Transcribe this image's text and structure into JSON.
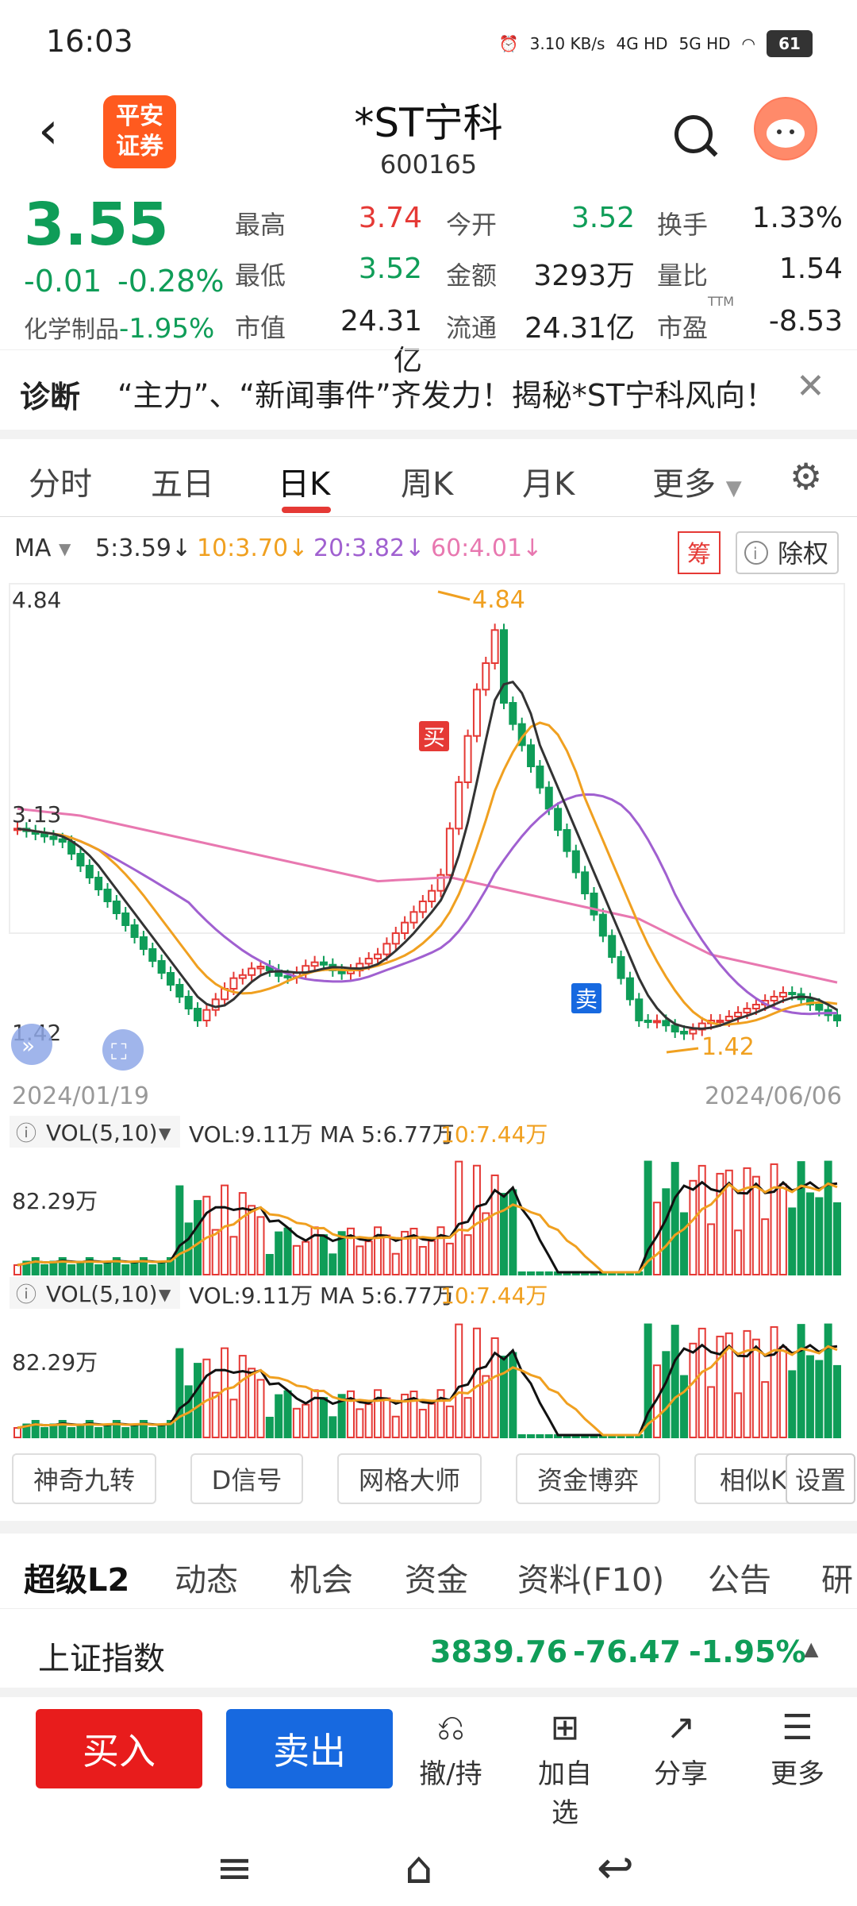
{
  "status": {
    "time": "16:03",
    "net_speed": "3.10 KB/s",
    "sig1": "4G HD",
    "sig2": "5G HD",
    "battery": "61"
  },
  "header": {
    "logo_text": "平安 证券",
    "stock_name": "*ST宁科",
    "stock_code": "600165"
  },
  "quote": {
    "price": "3.55",
    "change": "-0.01",
    "change_pct": "-0.28%",
    "sector_label": "化学制品",
    "sector_pct": "-1.95%",
    "fields": [
      {
        "label": "最高",
        "value": "3.74",
        "color": "red"
      },
      {
        "label": "今开",
        "value": "3.52",
        "color": "green"
      },
      {
        "label": "换手",
        "value": "1.33%",
        "color": "black"
      },
      {
        "label": "最低",
        "value": "3.52",
        "color": "green"
      },
      {
        "label": "金额",
        "value": "3293万",
        "color": "black"
      },
      {
        "label": "量比",
        "value": "1.54",
        "color": "black"
      },
      {
        "label": "市值",
        "value": "24.31亿",
        "color": "black"
      },
      {
        "label": "流通",
        "value": "24.31亿",
        "color": "black"
      },
      {
        "label": "市盈",
        "value": "-8.53",
        "color": "black"
      }
    ],
    "ttm": "TTM"
  },
  "diagnosis": {
    "tag": "诊断",
    "text": "“主力”、“新闻事件”齐发力！揭秘*ST宁科风向！"
  },
  "tabs": [
    "分时",
    "五日",
    "日K",
    "周K",
    "月K",
    "更多"
  ],
  "chart": {
    "ma_label": "MA",
    "ma_items": [
      {
        "text": "5:3.59↓",
        "color": "#333333"
      },
      {
        "text": "10:3.70↓",
        "color": "#f0a020"
      },
      {
        "text": "20:3.82↓",
        "color": "#a060d0"
      },
      {
        "text": "60:4.01↓",
        "color": "#e878b0"
      }
    ],
    "chip_btn": "筹",
    "exright_btn": "除权",
    "y_high": "4.84",
    "y_mid": "3.13",
    "y_low": "1.42",
    "max_label": "4.84",
    "min_label": "1.42",
    "buy_mark": "买",
    "sell_mark": "卖",
    "date_start": "2024/01/19",
    "date_end": "2024/06/06",
    "vol1": {
      "title": "VOL(5,10)",
      "stats": "VOL:9.11万 MA 5:6.77万",
      "ma10": "10:7.44万",
      "scale": "82.29万"
    },
    "vol2": {
      "title": "VOL(5,10)",
      "stats": "VOL:9.11万 MA 5:6.77万",
      "ma10": "10:7.44万",
      "scale": "82.29万"
    }
  },
  "tools": [
    "神奇九转",
    "D信号",
    "网格大师",
    "资金博弈",
    "相似K",
    "设置"
  ],
  "subtabs": [
    "超级L2",
    "动态",
    "机会",
    "资金",
    "资料(F10)",
    "公告",
    "研"
  ],
  "index": {
    "name": "上证指数",
    "value": "3839.76",
    "change": "-76.47",
    "pct": "-1.95%"
  },
  "bottom": {
    "buy": "买入",
    "sell": "卖出",
    "actions": [
      {
        "icon": "⎌",
        "label": "撤/持"
      },
      {
        "icon": "⊞",
        "label": "加自选"
      },
      {
        "icon": "↗",
        "label": "分享"
      },
      {
        "icon": "☰",
        "label": "更多"
      }
    ]
  },
  "colors": {
    "up": "#e53935",
    "down": "#0f9d58",
    "ma5": "#333333",
    "ma10": "#f0a020",
    "ma20": "#a060d0",
    "ma60": "#e878b0"
  }
}
